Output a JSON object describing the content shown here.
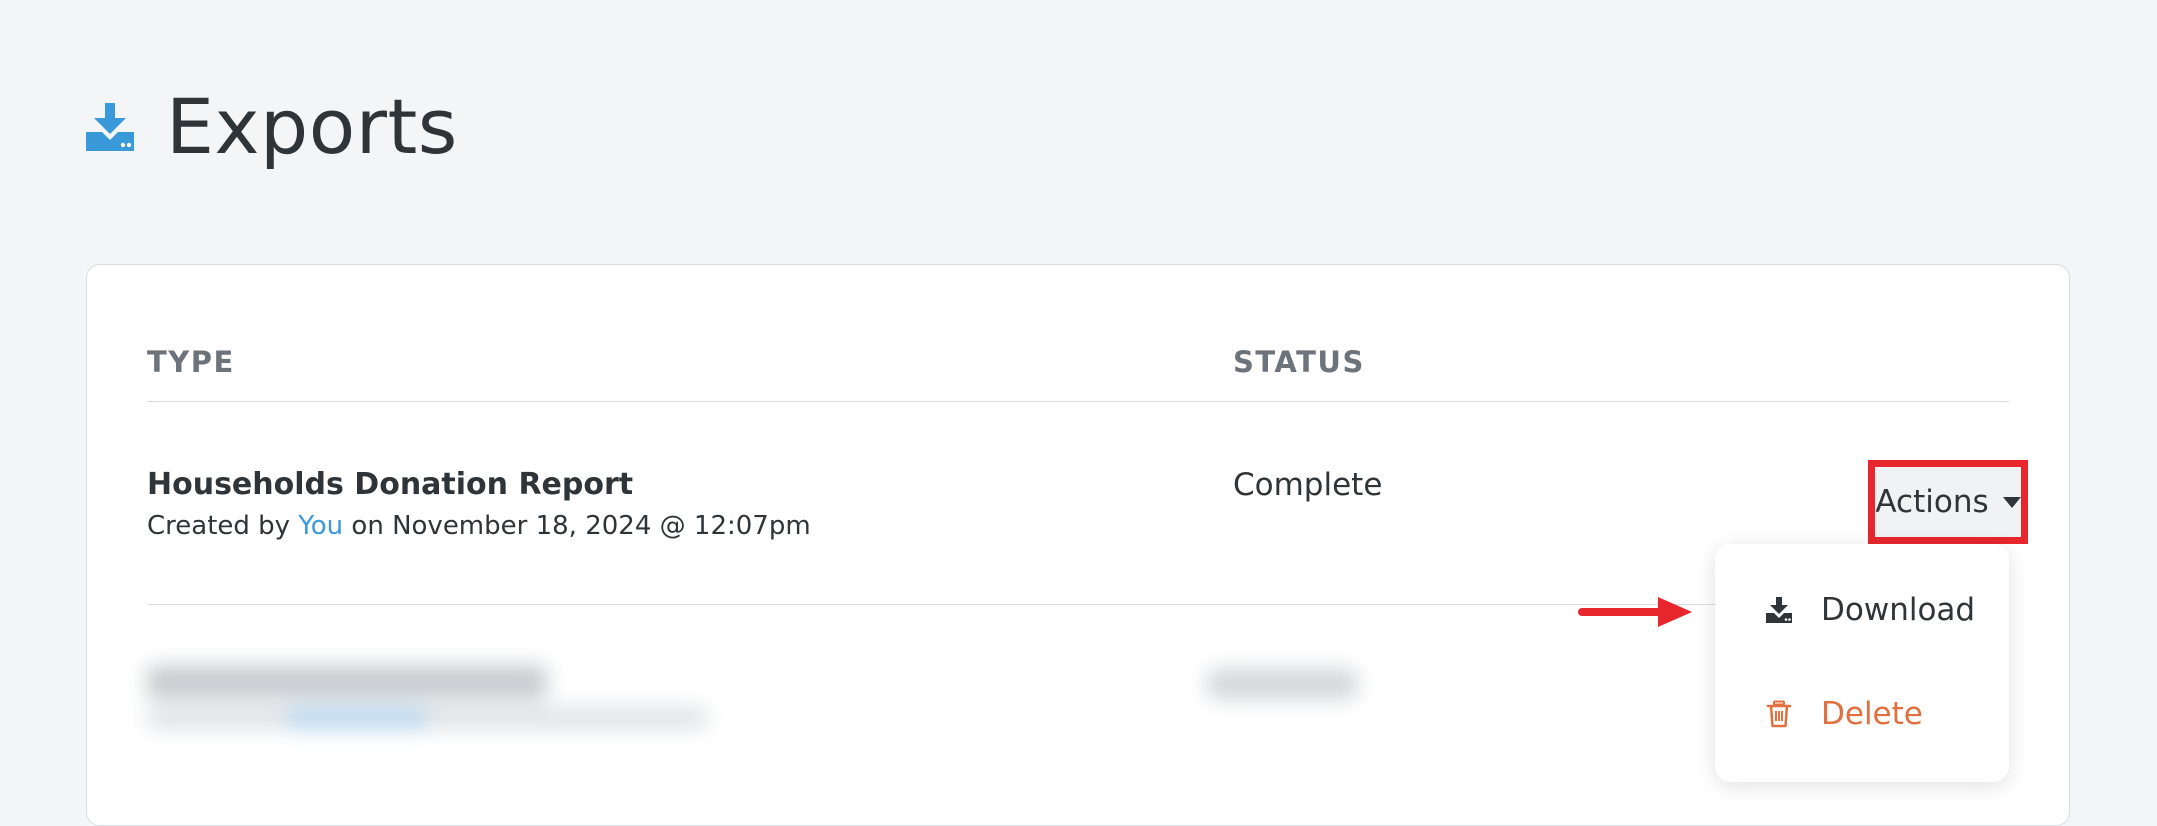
{
  "page": {
    "title": "Exports",
    "icon": "download-tray-icon",
    "accent_color": "#3a9ad9"
  },
  "table": {
    "columns": [
      "TYPE",
      "STATUS"
    ],
    "rows": [
      {
        "title": "Households Donation Report",
        "created_prefix": "Created by",
        "created_by": "You",
        "created_suffix": "on November 18, 2024 @ 12:07pm",
        "status": "Complete",
        "actions_label": "Actions"
      }
    ]
  },
  "actions_menu": {
    "items": [
      {
        "label": "Download",
        "icon": "download-icon",
        "color": "#2f3438"
      },
      {
        "label": "Delete",
        "icon": "trash-icon",
        "color": "#e0703f"
      }
    ]
  },
  "annotations": {
    "highlight_color": "#e8262d"
  }
}
